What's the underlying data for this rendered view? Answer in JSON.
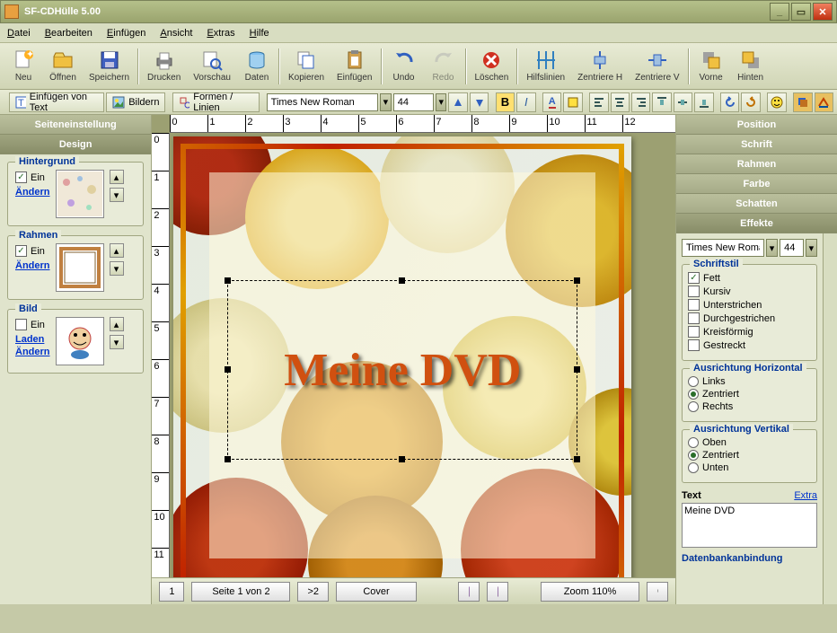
{
  "app": {
    "title": "SF-CDHülle 5.00"
  },
  "menu": [
    "Datei",
    "Bearbeiten",
    "Einfügen",
    "Ansicht",
    "Extras",
    "Hilfe"
  ],
  "toolbar1": [
    {
      "label": "Neu",
      "icon": "file-new"
    },
    {
      "label": "Öffnen",
      "icon": "folder-open"
    },
    {
      "label": "Speichern",
      "icon": "save"
    },
    {
      "sep": true
    },
    {
      "label": "Drucken",
      "icon": "print"
    },
    {
      "label": "Vorschau",
      "icon": "preview"
    },
    {
      "label": "Daten",
      "icon": "data"
    },
    {
      "sep": true
    },
    {
      "label": "Kopieren",
      "icon": "copy"
    },
    {
      "label": "Einfügen",
      "icon": "paste"
    },
    {
      "sep": true
    },
    {
      "label": "Undo",
      "icon": "undo"
    },
    {
      "label": "Redo",
      "icon": "redo",
      "disabled": true
    },
    {
      "sep": true
    },
    {
      "label": "Löschen",
      "icon": "delete"
    },
    {
      "sep": true
    },
    {
      "label": "Hilfslinien",
      "icon": "guides"
    },
    {
      "label": "Zentriere H",
      "icon": "center-h"
    },
    {
      "label": "Zentriere V",
      "icon": "center-v"
    },
    {
      "sep": true
    },
    {
      "label": "Vorne",
      "icon": "front"
    },
    {
      "label": "Hinten",
      "icon": "back"
    }
  ],
  "toolbar2": {
    "insert_text": "Einfügen von Text",
    "images": "Bildern",
    "shapes": "Formen / Linien",
    "font": "Times New Roman",
    "size": "44"
  },
  "left": {
    "tab1": "Seiteneinstellung",
    "tab2": "Design",
    "hintergrund": {
      "title": "Hintergrund",
      "ein": "Ein",
      "ein_checked": true,
      "andern": "Ändern"
    },
    "rahmen": {
      "title": "Rahmen",
      "ein": "Ein",
      "ein_checked": true,
      "andern": "Ändern"
    },
    "bild": {
      "title": "Bild",
      "ein": "Ein",
      "ein_checked": false,
      "laden": "Laden",
      "andern": "Ändern"
    }
  },
  "canvas": {
    "main_text": "Meine DVD",
    "ruler_range": [
      0,
      12
    ]
  },
  "bottombar": {
    "page1": "1",
    "pageinfo": "Seite 1 von 2",
    "pagenext": ">2",
    "cover": "Cover",
    "zoom": "Zoom 110%"
  },
  "right": {
    "tabs": [
      "Position",
      "Schrift",
      "Rahmen",
      "Farbe",
      "Schatten",
      "Effekte"
    ],
    "font": "Times New Roman",
    "size": "44",
    "schriftstil": {
      "title": "Schriftstil",
      "items": [
        {
          "label": "Fett",
          "checked": true
        },
        {
          "label": "Kursiv",
          "checked": false
        },
        {
          "label": "Unterstrichen",
          "checked": false
        },
        {
          "label": "Durchgestrichen",
          "checked": false
        },
        {
          "label": "Kreisförmig",
          "checked": false
        },
        {
          "label": "Gestreckt",
          "checked": false
        }
      ]
    },
    "halign": {
      "title": "Ausrichtung Horizontal",
      "items": [
        {
          "label": "Links",
          "sel": false
        },
        {
          "label": "Zentriert",
          "sel": true
        },
        {
          "label": "Rechts",
          "sel": false
        }
      ]
    },
    "valign": {
      "title": "Ausrichtung Vertikal",
      "items": [
        {
          "label": "Oben",
          "sel": false
        },
        {
          "label": "Zentriert",
          "sel": true
        },
        {
          "label": "Unten",
          "sel": false
        }
      ]
    },
    "textlabel": "Text",
    "extra": "Extra",
    "textvalue": "Meine DVD",
    "db": "Datenbankanbindung"
  }
}
